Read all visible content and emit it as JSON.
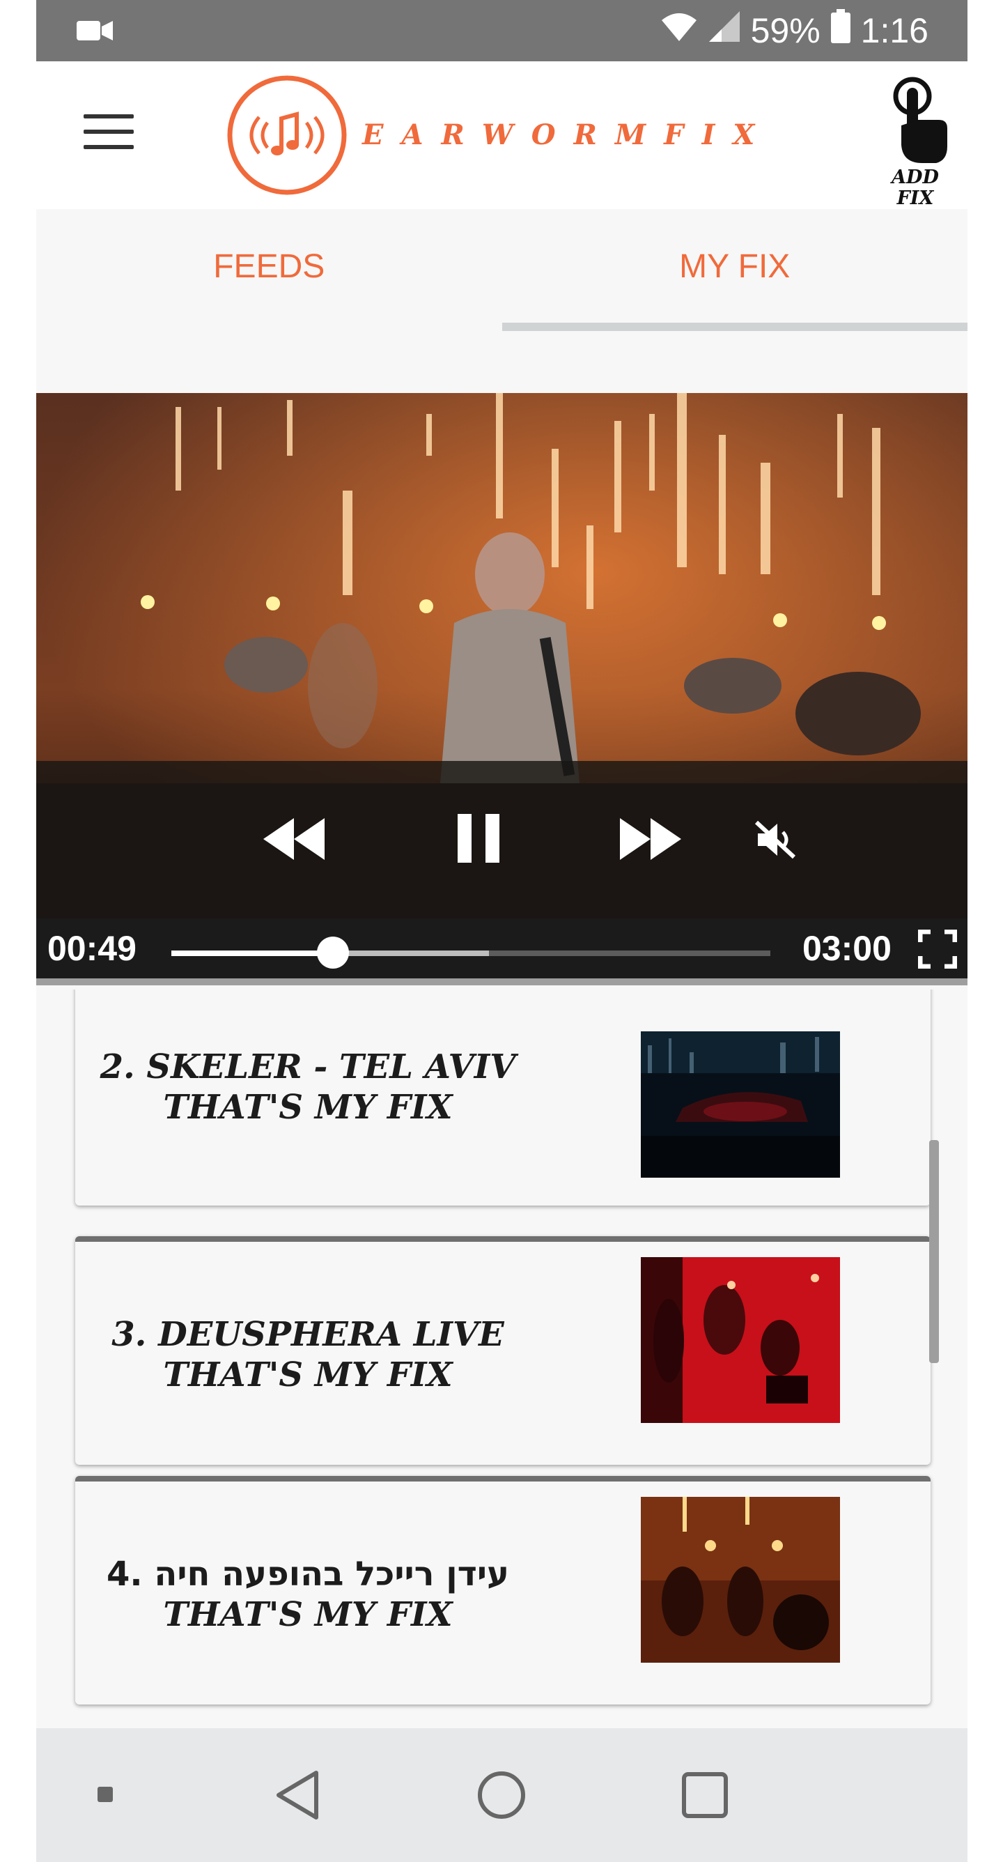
{
  "status_bar": {
    "left_icon": "video-camera-icon",
    "battery_percent": "59%",
    "time": "1:16",
    "wifi_icon": "wifi-icon",
    "signal_icon": "signal-icon",
    "battery_icon": "battery-icon"
  },
  "header": {
    "menu_icon": "hamburger-menu-icon",
    "logo_text": "EARWORMFIX",
    "add_fix_label": "ADD\nFIX",
    "add_fix_icon": "hand-pointer-icon",
    "brand_color": "#f06a3b"
  },
  "tabs": [
    {
      "label": "FEEDS",
      "active": false
    },
    {
      "label": "MY FIX",
      "active": true
    }
  ],
  "player": {
    "current_time": "00:49",
    "duration": "03:00",
    "progress_fraction": 0.27,
    "buffered_fraction": 0.53,
    "controls": [
      "rewind-icon",
      "pause-icon",
      "fast-forward-icon",
      "mute-icon",
      "fullscreen-icon"
    ]
  },
  "playlist": [
    {
      "line1": "2. SKELER - TEL AVIV",
      "line2": "THAT'S MY FIX"
    },
    {
      "line1": "3. DEUSPHERA LIVE",
      "line2": "THAT'S MY FIX"
    },
    {
      "line1": "עידן רייכל בהופעה חיה .4",
      "line2": "THAT'S MY FIX"
    }
  ],
  "nav_bar": {
    "buttons": [
      "dot-icon",
      "back-icon",
      "home-icon",
      "recents-icon"
    ]
  }
}
